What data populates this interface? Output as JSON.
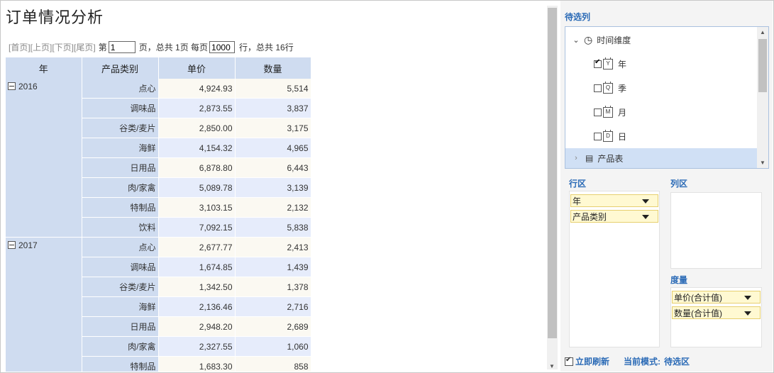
{
  "title": "订单情况分析",
  "pager": {
    "first": "[首页]",
    "prev": "[上页]",
    "next": "[下页]",
    "last": "[尾页]",
    "page_prefix": "第",
    "page_value": "1",
    "page_suffix": "页，总共 1页 每页",
    "page_size": "1000",
    "rows_suffix": "行，总共 16行"
  },
  "table": {
    "headers": [
      "年",
      "产品类别",
      "单价",
      "数量"
    ],
    "groups": [
      {
        "year": "2016",
        "rows": [
          {
            "category": "点心",
            "price": "4,924.93",
            "qty": "5,514"
          },
          {
            "category": "调味品",
            "price": "2,873.55",
            "qty": "3,837"
          },
          {
            "category": "谷类/麦片",
            "price": "2,850.00",
            "qty": "3,175"
          },
          {
            "category": "海鲜",
            "price": "4,154.32",
            "qty": "4,965"
          },
          {
            "category": "日用品",
            "price": "6,878.80",
            "qty": "6,443"
          },
          {
            "category": "肉/家禽",
            "price": "5,089.78",
            "qty": "3,139"
          },
          {
            "category": "特制品",
            "price": "3,103.15",
            "qty": "2,132"
          },
          {
            "category": "饮料",
            "price": "7,092.15",
            "qty": "5,838"
          }
        ]
      },
      {
        "year": "2017",
        "rows": [
          {
            "category": "点心",
            "price": "2,677.77",
            "qty": "2,413"
          },
          {
            "category": "调味品",
            "price": "1,674.85",
            "qty": "1,439"
          },
          {
            "category": "谷类/麦片",
            "price": "1,342.50",
            "qty": "1,378"
          },
          {
            "category": "海鲜",
            "price": "2,136.46",
            "qty": "2,716"
          },
          {
            "category": "日用品",
            "price": "2,948.20",
            "qty": "2,689"
          },
          {
            "category": "肉/家禽",
            "price": "2,327.55",
            "qty": "1,060"
          },
          {
            "category": "特制品",
            "price": "1,683.30",
            "qty": "858"
          }
        ]
      }
    ]
  },
  "panel": {
    "candidates_label": "待选列",
    "tree": {
      "time_dimension": "时间维度",
      "items": [
        {
          "label": "年",
          "icon": "Y",
          "checked": true
        },
        {
          "label": "季",
          "icon": "Q",
          "checked": false
        },
        {
          "label": "月",
          "icon": "M",
          "checked": false
        },
        {
          "label": "日",
          "icon": "D",
          "checked": false
        }
      ],
      "product_table": "产品表"
    },
    "row_zone_label": "行区",
    "col_zone_label": "列区",
    "measure_label": "度量",
    "row_fields": [
      "年",
      "产品类别"
    ],
    "measures": [
      "单价(合计值)",
      "数量(合计值)"
    ],
    "refresh_label": "立即刷新",
    "mode_prefix": "当前模式:",
    "mode_value": "待选区"
  }
}
